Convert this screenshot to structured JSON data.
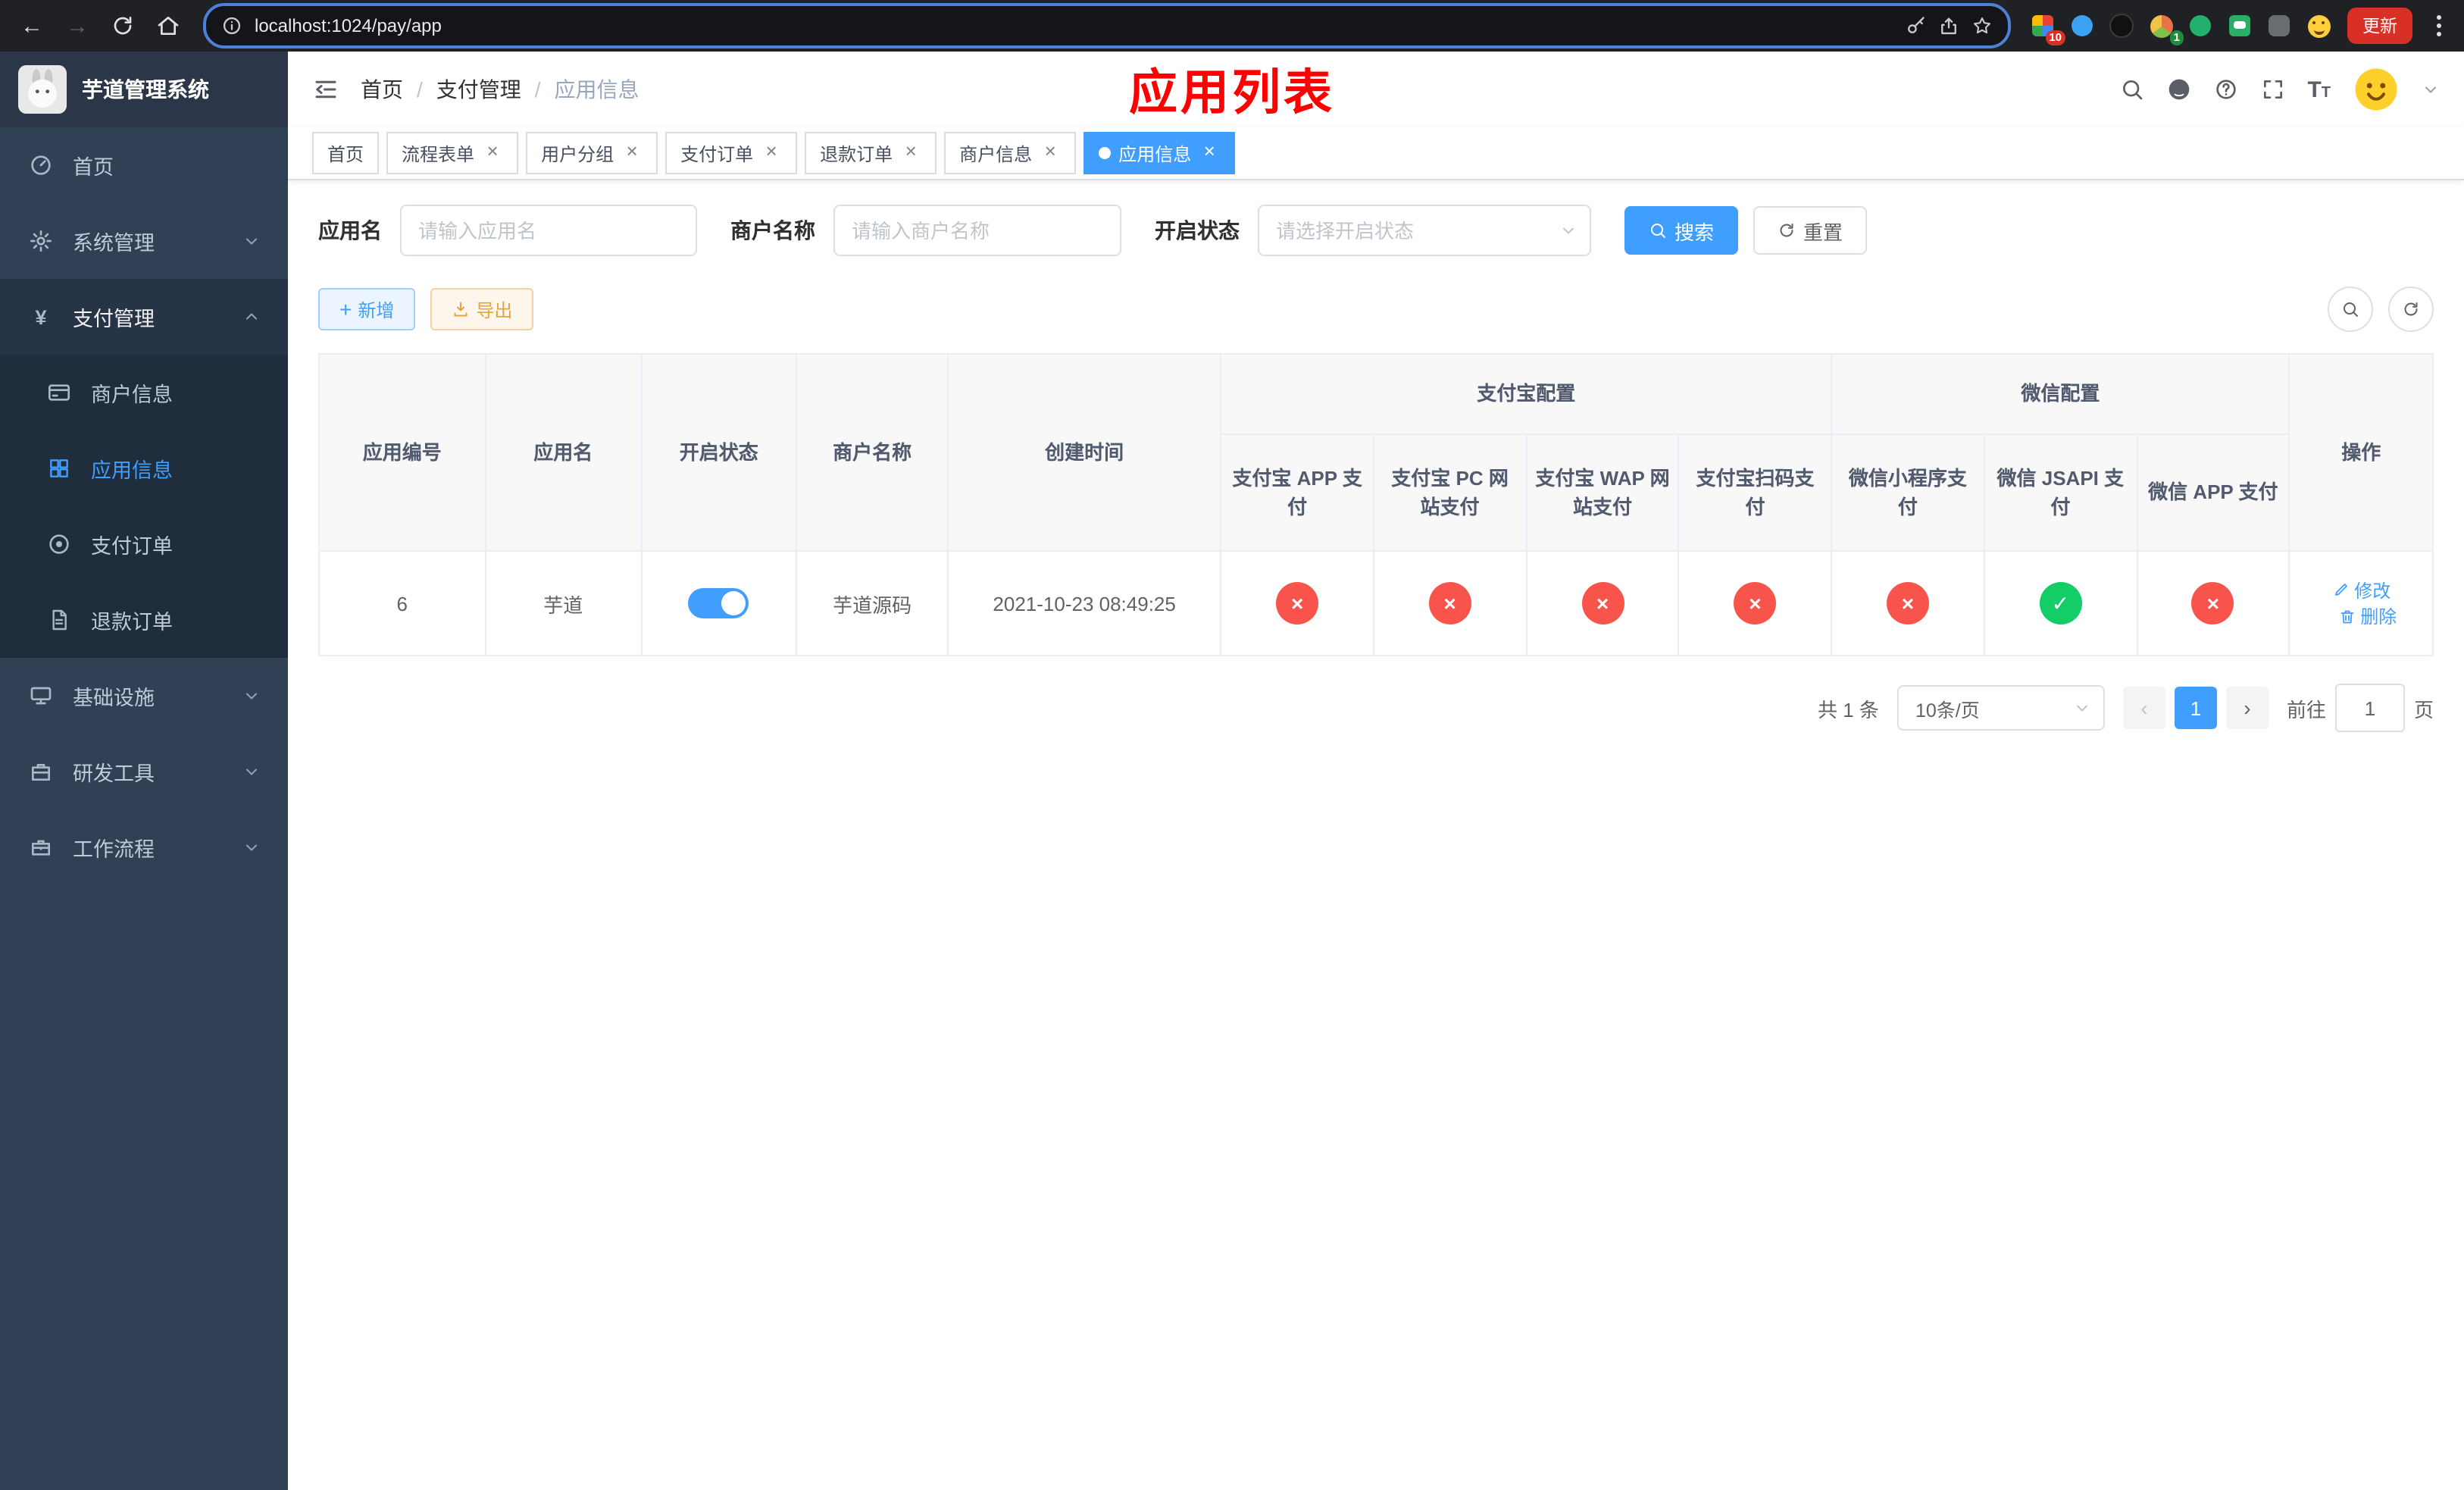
{
  "colors": {
    "primary": "#409eff",
    "success": "#13ce66",
    "danger": "#f9544b",
    "sidebar-bg": "#304156",
    "submenu-bg": "#1f2d3d",
    "title-red": "#ff0000",
    "update-red": "#d93025"
  },
  "browser": {
    "url": "localhost:1024/pay/app",
    "update_label": "更新",
    "extension_badge_count": "10",
    "profile_badge_count": "1"
  },
  "sidebar": {
    "logo_title": "芋道管理系统",
    "items": [
      {
        "label": "首页"
      },
      {
        "label": "系统管理"
      },
      {
        "label": "支付管理"
      },
      {
        "label": "基础设施"
      },
      {
        "label": "研发工具"
      },
      {
        "label": "工作流程"
      }
    ],
    "pay_children": [
      {
        "label": "商户信息"
      },
      {
        "label": "应用信息"
      },
      {
        "label": "支付订单"
      },
      {
        "label": "退款订单"
      }
    ]
  },
  "header": {
    "breadcrumb": [
      "首页",
      "支付管理",
      "应用信息"
    ],
    "page_overlay_title": "应用列表"
  },
  "tabs": [
    {
      "label": "首页"
    },
    {
      "label": "流程表单"
    },
    {
      "label": "用户分组"
    },
    {
      "label": "支付订单"
    },
    {
      "label": "退款订单"
    },
    {
      "label": "商户信息"
    },
    {
      "label": "应用信息"
    }
  ],
  "filters": {
    "app_name_label": "应用名",
    "app_name_placeholder": "请输入应用名",
    "merchant_label": "商户名称",
    "merchant_placeholder": "请输入商户名称",
    "status_label": "开启状态",
    "status_placeholder": "请选择开启状态",
    "search_label": "搜索",
    "reset_label": "重置"
  },
  "toolbar": {
    "add_label": "新增",
    "export_label": "导出"
  },
  "table": {
    "columns": {
      "app_id": "应用编号",
      "app_name": "应用名",
      "status": "开启状态",
      "merchant": "商户名称",
      "created": "创建时间",
      "actions": "操作"
    },
    "groups": [
      {
        "label": "支付宝配置",
        "children": [
          "支付宝 APP 支付",
          "支付宝 PC 网站支付",
          "支付宝 WAP 网站支付",
          "支付宝扫码支付"
        ]
      },
      {
        "label": "微信配置",
        "children": [
          "微信小程序支付",
          "微信 JSAPI 支付",
          "微信 APP 支付"
        ]
      }
    ],
    "rows": [
      {
        "app_id": "6",
        "app_name": "芋道",
        "enabled": true,
        "merchant": "芋道源码",
        "created": "2021-10-23 08:49:25",
        "channels": [
          "no",
          "no",
          "no",
          "no",
          "no",
          "yes",
          "no"
        ],
        "edit_label": "修改",
        "delete_label": "删除"
      }
    ]
  },
  "pagination": {
    "total_label": "共 1 条",
    "page_size_label": "10条/页",
    "current_page": "1",
    "goto_label": "前往",
    "goto_value": "1",
    "goto_unit": "页"
  },
  "icons": {
    "close": "×",
    "plus": "+",
    "back": "←",
    "forward": "→",
    "prev": "‹",
    "next": "›",
    "check": "✓",
    "cross": "×",
    "yen": "¥",
    "breadcrumb_sep": "/",
    "font_large": "T",
    "font_small": "T"
  }
}
